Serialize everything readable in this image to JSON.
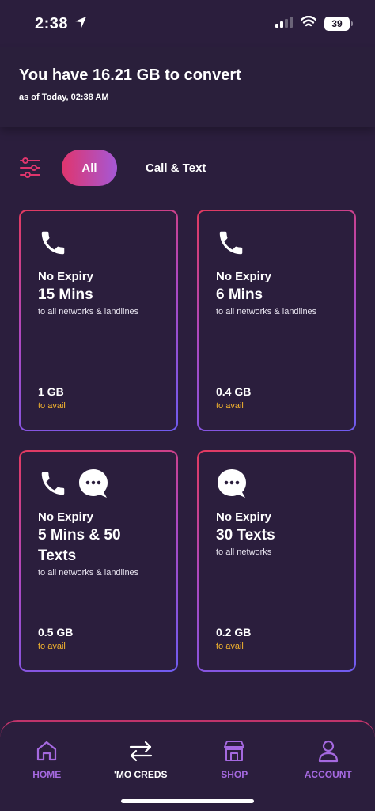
{
  "status_bar": {
    "time": "2:38",
    "battery": "39"
  },
  "header": {
    "title": "You have 16.21 GB to convert",
    "subtitle": "as of Today, 02:38 AM"
  },
  "filters": {
    "all_label": "All",
    "call_text_label": "Call & Text"
  },
  "cards": [
    {
      "icons": [
        "phone-icon"
      ],
      "kicker": "No Expiry",
      "title": "15 Mins",
      "desc": "to all networks & landlines",
      "gb": "1 GB",
      "avail": "to avail"
    },
    {
      "icons": [
        "phone-icon"
      ],
      "kicker": "No Expiry",
      "title": "6 Mins",
      "desc": "to all networks & landlines",
      "gb": "0.4 GB",
      "avail": "to avail"
    },
    {
      "icons": [
        "phone-icon",
        "chat-bubble-icon"
      ],
      "kicker": "No Expiry",
      "title": "5 Mins & 50 Texts",
      "desc": "to all networks & landlines",
      "gb": "0.5 GB",
      "avail": "to avail"
    },
    {
      "icons": [
        "chat-bubble-icon"
      ],
      "kicker": "No Expiry",
      "title": "30 Texts",
      "desc": "to all networks",
      "gb": "0.2 GB",
      "avail": "to avail"
    }
  ],
  "nav": {
    "home": "HOME",
    "mo_creds": "'MO CREDS",
    "shop": "SHOP",
    "account": "ACCOUNT"
  },
  "colors": {
    "accent_pink": "#e0356d",
    "accent_purple": "#a558d6",
    "avail_gold": "#f5b52e",
    "nav_purple": "#a569e0"
  }
}
